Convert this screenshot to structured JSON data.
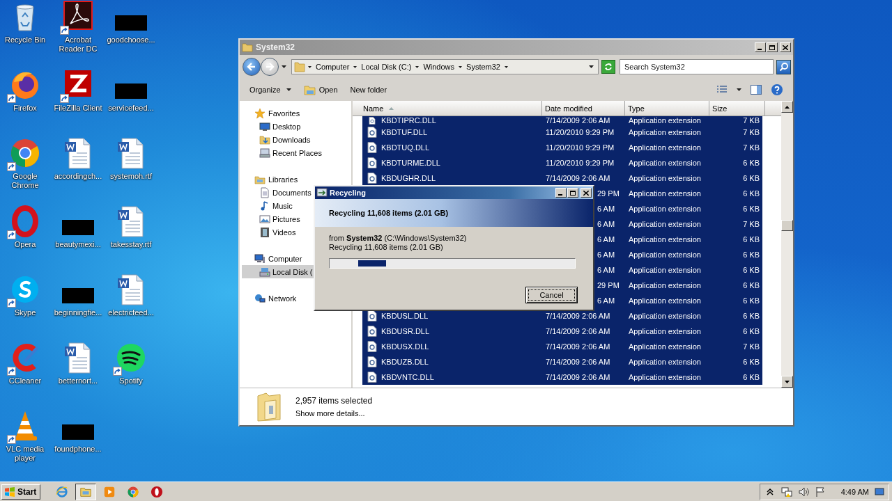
{
  "desktop": {
    "icons": [
      {
        "label": "Recycle Bin",
        "kind": "recycle-bin",
        "shortcut": false
      },
      {
        "label": "Firefox",
        "kind": "firefox",
        "shortcut": true
      },
      {
        "label": "Google Chrome",
        "kind": "chrome",
        "shortcut": true
      },
      {
        "label": "Opera",
        "kind": "opera",
        "shortcut": true
      },
      {
        "label": "Skype",
        "kind": "skype",
        "shortcut": true
      },
      {
        "label": "CCleaner",
        "kind": "ccleaner",
        "shortcut": true
      },
      {
        "label": "VLC media player",
        "kind": "vlc",
        "shortcut": true
      },
      {
        "label": "Acrobat Reader DC",
        "kind": "acrobat",
        "shortcut": true
      },
      {
        "label": "FileZilla Client",
        "kind": "filezilla",
        "shortcut": true
      },
      {
        "label": "accordingch...",
        "kind": "word",
        "shortcut": false
      },
      {
        "label": "beautymexi...",
        "kind": "redacted",
        "shortcut": false
      },
      {
        "label": "beginningfie...",
        "kind": "redacted",
        "shortcut": false
      },
      {
        "label": "betternort...",
        "kind": "word",
        "shortcut": false
      },
      {
        "label": "foundphone...",
        "kind": "redacted",
        "shortcut": false
      },
      {
        "label": "goodchoose...",
        "kind": "redacted",
        "shortcut": false
      },
      {
        "label": "servicefeed...",
        "kind": "redacted",
        "shortcut": false
      },
      {
        "label": "systemoh.rtf",
        "kind": "word",
        "shortcut": false
      },
      {
        "label": "takesstay.rtf",
        "kind": "word",
        "shortcut": false
      },
      {
        "label": "electricfeed...",
        "kind": "word",
        "shortcut": false
      },
      {
        "label": "Spotify",
        "kind": "spotify",
        "shortcut": true
      }
    ]
  },
  "explorer": {
    "title": "System32",
    "breadcrumb": [
      "Computer",
      "Local Disk (C:)",
      "Windows",
      "System32"
    ],
    "search": {
      "placeholder": "Search System32"
    },
    "toolbar": [
      {
        "label": "Organize",
        "kind": "menu"
      },
      {
        "label": "Open",
        "kind": "open"
      },
      {
        "label": "New folder",
        "kind": "plain"
      }
    ],
    "nav": [
      {
        "label": "Favorites",
        "kind": "star",
        "selected": false,
        "children": [
          {
            "label": "Desktop",
            "kind": "desktop",
            "selected": false
          },
          {
            "label": "Downloads",
            "kind": "downloads",
            "selected": false
          },
          {
            "label": "Recent Places",
            "kind": "recent",
            "selected": false
          }
        ]
      },
      {
        "label": "Libraries",
        "kind": "libraries",
        "selected": false,
        "children": [
          {
            "label": "Documents",
            "kind": "documents",
            "selected": false
          },
          {
            "label": "Music",
            "kind": "music",
            "selected": false
          },
          {
            "label": "Pictures",
            "kind": "pictures",
            "selected": false
          },
          {
            "label": "Videos",
            "kind": "videos",
            "selected": false
          }
        ]
      },
      {
        "label": "Computer",
        "kind": "computer",
        "selected": false,
        "children": [
          {
            "label": "Local Disk (",
            "kind": "disk",
            "selected": true
          }
        ]
      },
      {
        "label": "Network",
        "kind": "network",
        "selected": false
      }
    ],
    "columns": [
      {
        "label": "Name",
        "sorted": true
      },
      {
        "label": "Date modified",
        "sorted": false
      },
      {
        "label": "Type",
        "sorted": false
      },
      {
        "label": "Size",
        "sorted": false
      }
    ],
    "rows": [
      {
        "name": "KBDTIPRC.DLL",
        "date": "7/14/2009 2:06 AM",
        "type": "Application extension",
        "size": "7 KB",
        "selected": true
      },
      {
        "name": "KBDTUF.DLL",
        "date": "11/20/2010 9:29 PM",
        "type": "Application extension",
        "size": "7 KB",
        "selected": true
      },
      {
        "name": "KBDTUQ.DLL",
        "date": "11/20/2010 9:29 PM",
        "type": "Application extension",
        "size": "7 KB",
        "selected": true
      },
      {
        "name": "KBDTURME.DLL",
        "date": "11/20/2010 9:29 PM",
        "type": "Application extension",
        "size": "6 KB",
        "selected": true
      },
      {
        "name": "KBDUGHR.DLL",
        "date": "7/14/2009 2:06 AM",
        "type": "Application extension",
        "size": "6 KB",
        "selected": true
      },
      {
        "date": "29 PM",
        "type": "Application extension",
        "size": "6 KB",
        "selected": true
      },
      {
        "date": "6 AM",
        "type": "Application extension",
        "size": "6 KB",
        "selected": true
      },
      {
        "date": "6 AM",
        "type": "Application extension",
        "size": "7 KB",
        "selected": true
      },
      {
        "date": "6 AM",
        "type": "Application extension",
        "size": "6 KB",
        "selected": true
      },
      {
        "date": "6 AM",
        "type": "Application extension",
        "size": "6 KB",
        "selected": true
      },
      {
        "date": "6 AM",
        "type": "Application extension",
        "size": "6 KB",
        "selected": true
      },
      {
        "date": "29 PM",
        "type": "Application extension",
        "size": "6 KB",
        "selected": true
      },
      {
        "date": "6 AM",
        "type": "Application extension",
        "size": "6 KB",
        "selected": true
      },
      {
        "name": "KBDUSL.DLL",
        "date": "7/14/2009 2:06 AM",
        "type": "Application extension",
        "size": "6 KB",
        "selected": true
      },
      {
        "name": "KBDUSR.DLL",
        "date": "7/14/2009 2:06 AM",
        "type": "Application extension",
        "size": "6 KB",
        "selected": true
      },
      {
        "name": "KBDUSX.DLL",
        "date": "7/14/2009 2:06 AM",
        "type": "Application extension",
        "size": "7 KB",
        "selected": true
      },
      {
        "name": "KBDUZB.DLL",
        "date": "7/14/2009 2:06 AM",
        "type": "Application extension",
        "size": "6 KB",
        "selected": true
      },
      {
        "name": "KBDVNTC.DLL",
        "date": "7/14/2009 2:06 AM",
        "type": "Application extension",
        "size": "6 KB",
        "selected": true
      }
    ],
    "details": {
      "count": "2,957 items selected",
      "link": "Show more details..."
    }
  },
  "dialog": {
    "title": "Recycling",
    "heading": "Recycling 11,608 items (2.01 GB)",
    "from": "from **System32** (C:\\Windows\\System32)",
    "status": "Recycling 11,608 items (2.01 GB)",
    "progress": {
      "level": 0.23
    },
    "cancel": "Cancel"
  },
  "taskbar": {
    "start": "Start",
    "apps": [
      {
        "kind": "ie",
        "active": false
      },
      {
        "kind": "explorer",
        "active": true
      },
      {
        "kind": "media",
        "active": false
      },
      {
        "kind": "chrome",
        "active": false
      },
      {
        "kind": "opera",
        "active": false
      }
    ],
    "clock": "4:49 AM"
  }
}
